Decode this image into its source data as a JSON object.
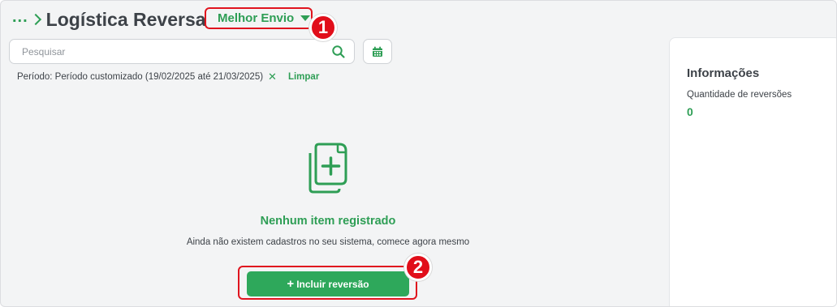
{
  "header": {
    "breadcrumb_ellipsis": "...",
    "title": "Logística Reversa",
    "app_selector": "Melhor Envio"
  },
  "search": {
    "placeholder": "Pesquisar",
    "value": ""
  },
  "filter": {
    "label": "Período: Período customizado (19/02/2025 até 21/03/2025)",
    "remove_symbol": "✕",
    "clear_label": "Limpar"
  },
  "empty_state": {
    "title": "Nenhum item registrado",
    "description": "Ainda não existem cadastros no seu sistema, comece agora mesmo",
    "button_plus": "+",
    "button_label": "Incluir reversão"
  },
  "info": {
    "title": "Informações",
    "label": "Quantidade de reversões",
    "value": "0"
  },
  "annotations": {
    "badge_1": "1",
    "badge_2": "2"
  },
  "colors": {
    "accent_green": "#2e9e55",
    "button_green": "#2ea85b",
    "highlight_red": "#e0141e"
  },
  "icons": [
    "chevron-right-icon",
    "caret-down-icon",
    "search-icon",
    "calendar-icon",
    "close-icon",
    "add-documents-icon",
    "plus-icon"
  ]
}
